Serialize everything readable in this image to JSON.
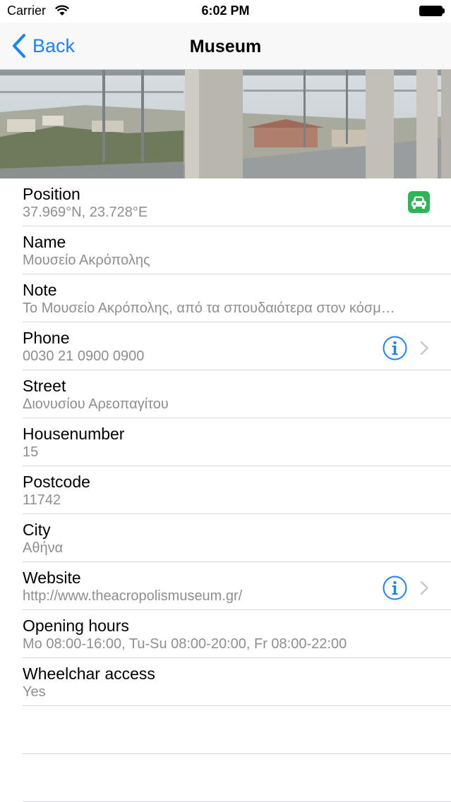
{
  "status_bar": {
    "carrier": "Carrier",
    "time": "6:02 PM"
  },
  "nav": {
    "back_label": "Back",
    "title": "Museum"
  },
  "colors": {
    "accent": "#1a82fb",
    "nav_background": "#f8f8f8",
    "secondary_text": "#8e8e93",
    "car_badge": "#2fb457"
  },
  "header_image": {
    "description_icon": "museum-photo"
  },
  "rows": [
    {
      "title": "Position",
      "value": "37.969°N, 23.728°E",
      "accessory": "car-icon"
    },
    {
      "title": "Name",
      "value": "Μουσείο Ακρόπολης"
    },
    {
      "title": "Note",
      "value": "Το Μουσείο Ακρόπολης, από τα σπουδαιότερα στον κόσμ…"
    },
    {
      "title": "Phone",
      "value": "0030 21 0900 0900",
      "accessory": "info-icon"
    },
    {
      "title": "Street",
      "value": "Διονυσίου Αρεοπαγίτου"
    },
    {
      "title": "Housenumber",
      "value": "15"
    },
    {
      "title": "Postcode",
      "value": "11742"
    },
    {
      "title": "City",
      "value": "Αθήνα"
    },
    {
      "title": "Website",
      "value": "http://www.theacropolismuseum.gr/",
      "accessory": "info-icon"
    },
    {
      "title": "Opening hours",
      "value": "Mo 08:00-16:00, Tu-Su 08:00-20:00, Fr 08:00-22:00"
    },
    {
      "title": "Wheelchar access",
      "value": "Yes"
    }
  ]
}
